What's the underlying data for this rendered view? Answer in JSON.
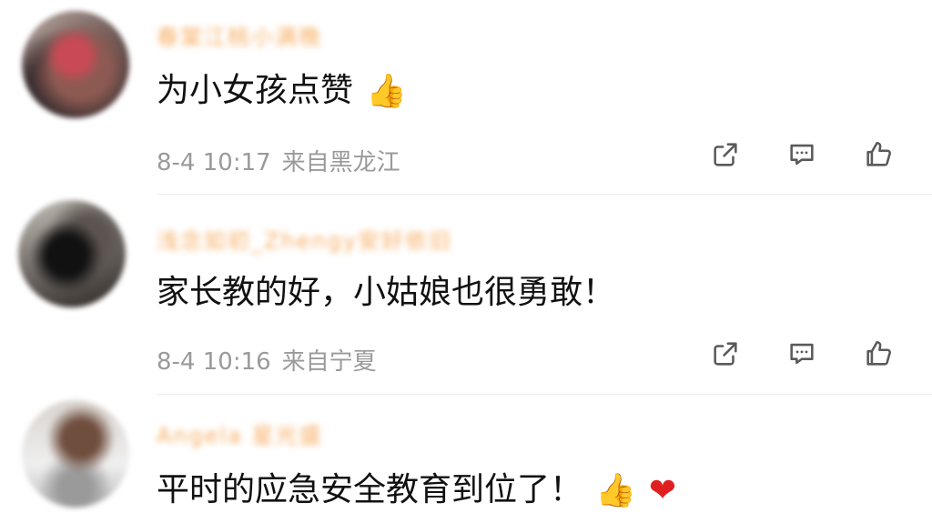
{
  "comments": [
    {
      "username": "春棠江桃小满晚",
      "text": "为小女孩点赞",
      "emojis": [
        "thumbs-up"
      ],
      "date": "8-4 10:17",
      "source": "来自黑龙江"
    },
    {
      "username": "浅念如初_Zhengy安好依旧",
      "text": "家长教的好，小姑娘也很勇敢！",
      "emojis": [],
      "date": "8-4 10:16",
      "source": "来自宁夏"
    },
    {
      "username": "Angela 星光盛",
      "text": "平时的应急安全教育到位了！",
      "emojis": [
        "thumbs-up",
        "red-heart"
      ]
    }
  ],
  "emoji_glyphs": {
    "thumbs_up": "👍",
    "red_heart": "❤"
  },
  "actions": {
    "share_icon": "share-icon",
    "comment_icon": "comment-icon",
    "like_icon": "thumbs-up-icon"
  },
  "colors": {
    "username_blur": "#f6a24d",
    "text": "#111111",
    "meta": "#9a9a9a",
    "icon": "#5a5a5a",
    "divider": "#ececec"
  }
}
